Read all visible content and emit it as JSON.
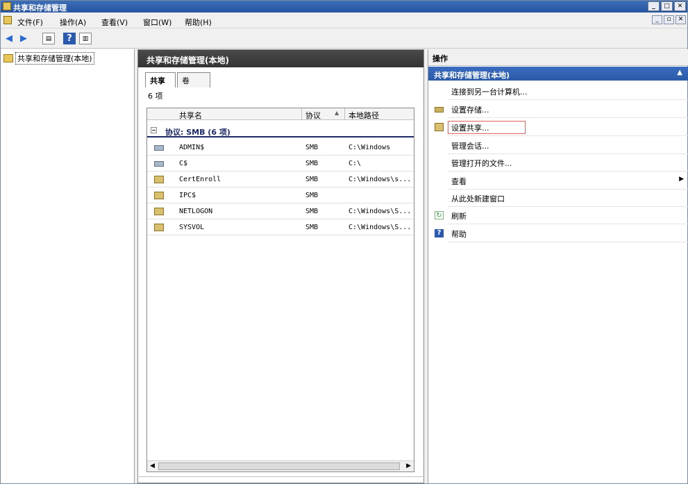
{
  "window": {
    "title": "共享和存储管理"
  },
  "menu": [
    "文件(F)",
    "操作(A)",
    "查看(V)",
    "窗口(W)",
    "帮助(H)"
  ],
  "tree": {
    "root": "共享和存储管理(本地)"
  },
  "center": {
    "title": "共享和存储管理(本地)",
    "tabs": [
      "共享",
      "卷"
    ],
    "count": "6 项",
    "columns": [
      "共享名",
      "协议",
      "本地路径"
    ],
    "group": "协议: SMB (6 项)",
    "rows": [
      {
        "name": "ADMIN$",
        "protocol": "SMB",
        "path": "C:\\Windows",
        "icon": "drive-share-icon"
      },
      {
        "name": "C$",
        "protocol": "SMB",
        "path": "C:\\",
        "icon": "drive-share-icon"
      },
      {
        "name": "CertEnroll",
        "protocol": "SMB",
        "path": "C:\\Windows\\s...",
        "icon": "folder-share-icon"
      },
      {
        "name": "IPC$",
        "protocol": "SMB",
        "path": "",
        "icon": "folder-share-icon"
      },
      {
        "name": "NETLOGON",
        "protocol": "SMB",
        "path": "C:\\Windows\\S...",
        "icon": "folder-share-icon"
      },
      {
        "name": "SYSVOL",
        "protocol": "SMB",
        "path": "C:\\Windows\\S...",
        "icon": "folder-share-icon"
      }
    ]
  },
  "actions": {
    "header": "操作",
    "section": "共享和存储管理(本地)",
    "items": [
      {
        "label": "连接到另一台计算机...",
        "icon": ""
      },
      {
        "label": "设置存储...",
        "icon": "storage-icon"
      },
      {
        "label": "设置共享...",
        "icon": "share-icon"
      },
      {
        "label": "管理会话...",
        "icon": ""
      },
      {
        "label": "管理打开的文件...",
        "icon": ""
      },
      {
        "label": "查看",
        "icon": ""
      },
      {
        "label": "从此处新建窗口",
        "icon": ""
      },
      {
        "label": "刷新",
        "icon": "refresh-icon"
      },
      {
        "label": "帮助",
        "icon": "help-icon"
      }
    ]
  },
  "colors": {
    "title_bar": "#2553a0",
    "section_bar": "#3a6cc0",
    "center_header": "#3d3d3d",
    "group_text": "#1e2a6a",
    "highlight_box": "#e06060"
  }
}
